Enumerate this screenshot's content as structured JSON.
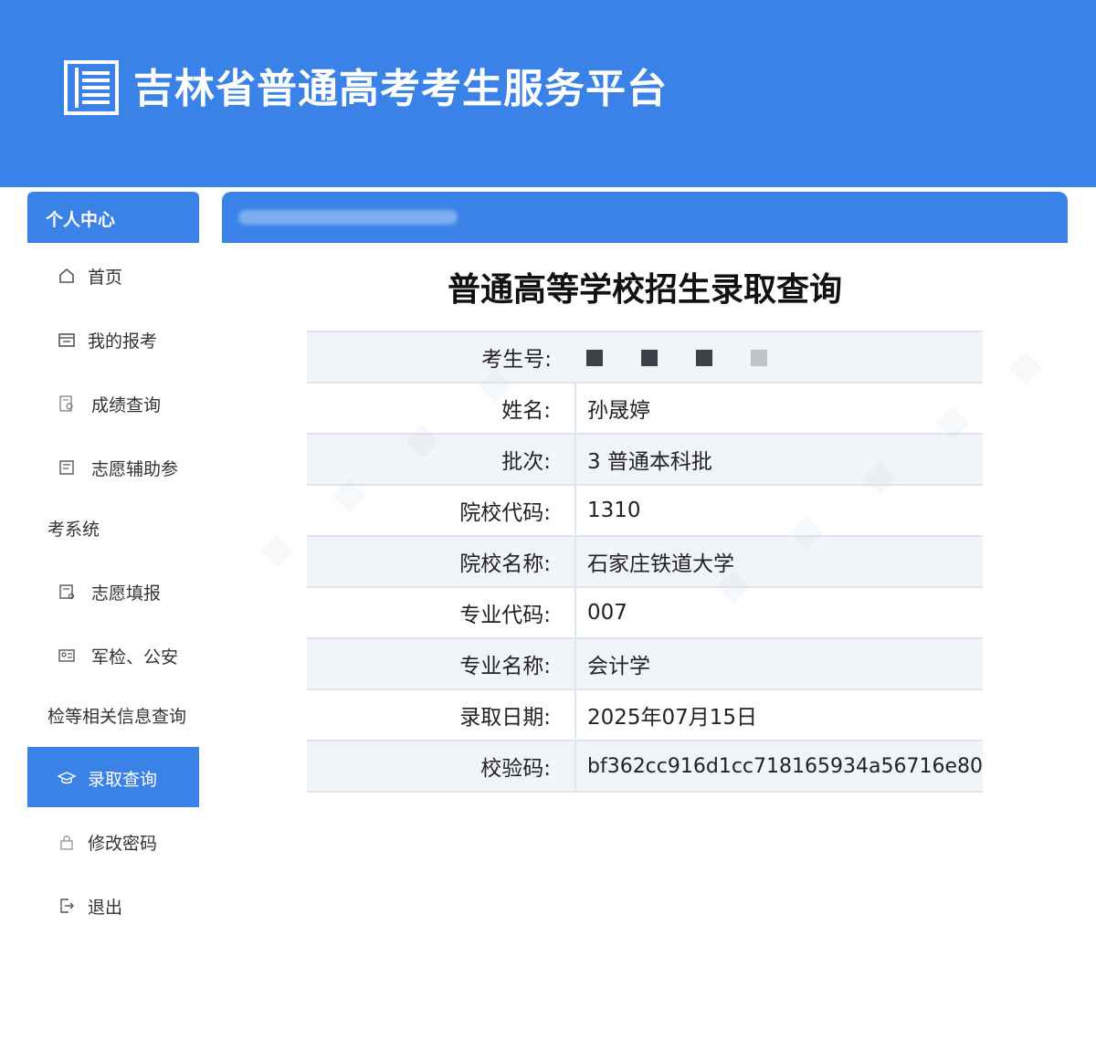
{
  "header": {
    "title": "吉林省普通高考考生服务平台",
    "logo_icon": "document-lines-icon",
    "bg_color": "#3b82e8"
  },
  "sidebar": {
    "section_title": "个人中心",
    "items": [
      {
        "label": "首页",
        "icon": "home-icon"
      },
      {
        "label": "我的报考",
        "icon": "calendar-icon"
      },
      {
        "label": "成绩查询",
        "icon": "score-doc-icon"
      },
      {
        "label": "志愿辅助参",
        "label_cont": "考系统",
        "icon": "assist-doc-icon"
      },
      {
        "label": "志愿填报",
        "icon": "form-edit-icon"
      },
      {
        "label": "军检、公安",
        "label_cont": "检等相关信息查询",
        "icon": "id-card-icon"
      },
      {
        "label": "录取查询",
        "icon": "graduation-cap-icon",
        "active": true
      },
      {
        "label": "修改密码",
        "icon": "lock-icon"
      },
      {
        "label": "退出",
        "icon": "logout-icon"
      }
    ]
  },
  "main": {
    "title": "普通高等学校招生录取查询",
    "fields": [
      {
        "key": "考生号:",
        "value": ""
      },
      {
        "key": "姓名:",
        "value": "孙晟婷"
      },
      {
        "key": "批次:",
        "value": "3 普通本科批"
      },
      {
        "key": "院校代码:",
        "value": "1310"
      },
      {
        "key": "院校名称:",
        "value": "石家庄铁道大学"
      },
      {
        "key": "专业代码:",
        "value": "007"
      },
      {
        "key": "专业名称:",
        "value": "会计学"
      },
      {
        "key": "录取日期:",
        "value": "2025年07月15日"
      },
      {
        "key": "校验码:",
        "value": "bf362cc916d1cc718165934a56716e80"
      }
    ]
  }
}
